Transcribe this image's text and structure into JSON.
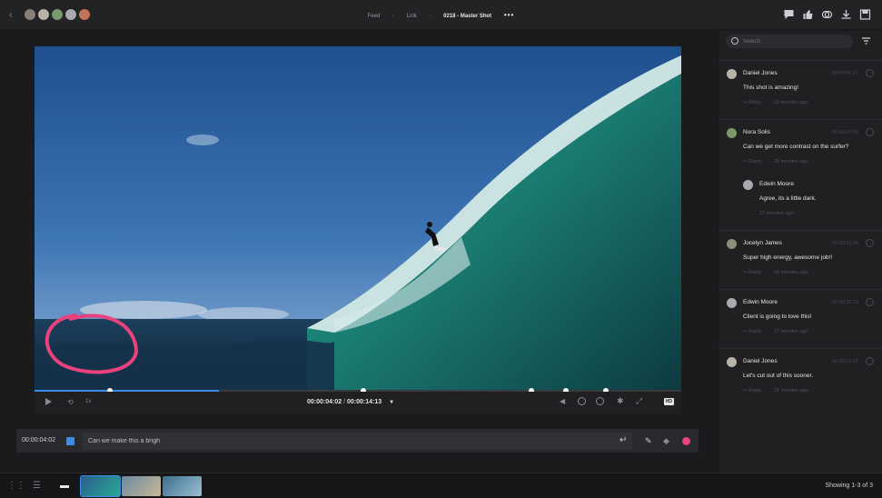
{
  "breadcrumb": [
    "Feed",
    "Link",
    "0218 - Master Shot"
  ],
  "player": {
    "current_time": "00:00:04:02",
    "duration": "00:00:14:13",
    "speed": "1x",
    "hd_badge": "HD",
    "progress_fraction": 0.285,
    "marker_positions": [
      0.116,
      0.508,
      0.768,
      0.822,
      0.883
    ]
  },
  "composer": {
    "timecode": "00:00:04:02",
    "value": "Can we make this a brigh"
  },
  "search": {
    "placeholder": "Search"
  },
  "comments": [
    {
      "author": "Daniel Jones",
      "time": "00:00:01:17",
      "text": "This shot is amazing!",
      "reply": "Reply",
      "ago": "32 minutes ago",
      "avatar_color": "#b9b2a8"
    },
    {
      "author": "Nora Solis",
      "time": "00:00:07:06",
      "text": "Can we get more contrast on the surfer?",
      "reply": "Reply",
      "ago": "28 minutes ago",
      "avatar_color": "#7a9a6c"
    },
    {
      "author": "Edwin Moore",
      "time": "",
      "text": "Agree, its a little dark.",
      "reply": "",
      "ago": "27 minutes ago",
      "avatar_color": "#a9a9ae",
      "is_reply": true
    },
    {
      "author": "Jocelyn James",
      "time": "00:00:11:04",
      "text": "Super high energy, awesome job!!",
      "reply": "Reply",
      "ago": "30 minutes ago",
      "avatar_color": "#8c8f7a"
    },
    {
      "author": "Edwin Moore",
      "time": "00:00:11:23",
      "text": "Client is going to love this!",
      "reply": "Reply",
      "ago": "27 minutes ago",
      "avatar_color": "#a9a9ae"
    },
    {
      "author": "Daniel Jones",
      "time": "00:00:12:21",
      "text": "Let's cut out of this sooner.",
      "reply": "Reply",
      "ago": "31 minutes ago",
      "avatar_color": "#b9b2a8"
    }
  ],
  "footer": {
    "showing": "Showing 1-3 of 3"
  },
  "colors": {
    "accent": "#3a8ee6",
    "annotation": "#e8437e"
  }
}
